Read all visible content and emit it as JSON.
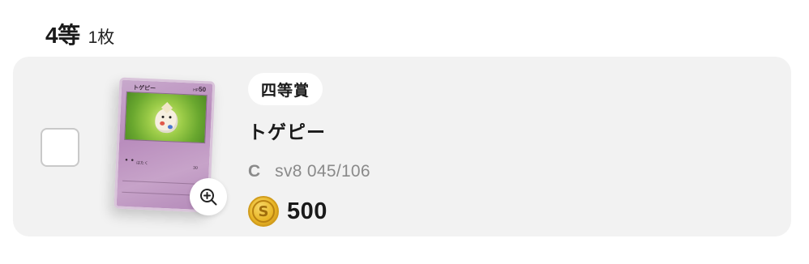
{
  "section": {
    "tier_label": "4等",
    "count_label": "1枚"
  },
  "prize": {
    "badge": "四等賞",
    "card_name": "トゲピー",
    "rarity": "C",
    "set_number": "sv8 045/106",
    "price": "500",
    "price_icon": "coin-icon",
    "coin_symbol": "S",
    "zoom_icon": "zoom-in-icon"
  },
  "card_art": {
    "name": "トゲピー",
    "hp": "50",
    "hp_prefix": "HP",
    "attack": "はたく",
    "damage": "30"
  },
  "colors": {
    "row_background": "#f2f2f2",
    "badge_background": "#ffffff",
    "coin": "#e8b526",
    "muted_text": "#8a8a8a"
  }
}
